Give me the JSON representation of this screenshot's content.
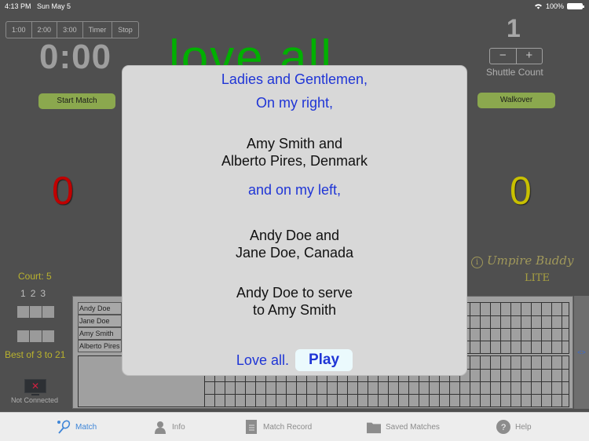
{
  "status_bar": {
    "time": "4:13 PM",
    "date": "Sun May 5",
    "battery": "100%"
  },
  "timer_controls": {
    "options": [
      "1:00",
      "2:00",
      "3:00",
      "Timer",
      "Stop"
    ]
  },
  "clock": "0:00",
  "announcement_bg": "love  all",
  "buttons": {
    "start_match": "Start Match",
    "walkover": "Walkover"
  },
  "shuttle": {
    "count": "1",
    "minus": "−",
    "plus": "+",
    "label": "Shuttle Count"
  },
  "scores": {
    "left": "0",
    "right": "0",
    "left_color": "#c00000",
    "right_color": "#c8c000"
  },
  "brand": {
    "name": "Umpire Buddy",
    "edition": "LITE",
    "info_glyph": "i"
  },
  "match_info": {
    "court": "Court: 5",
    "game_numbers": [
      "1",
      "2",
      "3"
    ],
    "format": "Best of 3 to 21",
    "connection": "Not Connected",
    "connection_glyph": "✕"
  },
  "scoresheet": {
    "players": [
      "Andy Doe",
      "Jane Doe",
      "Amy Smith",
      "Alberto Pires"
    ],
    "nav_label": "<>"
  },
  "dialog": {
    "intro": "Ladies and Gentlemen,",
    "right_intro": "On my right,",
    "right_team_line1": "Amy Smith and",
    "right_team_line2": "Alberto Pires, Denmark",
    "left_intro": "and on my left,",
    "left_team_line1": "Andy Doe and",
    "left_team_line2": "Jane Doe, Canada",
    "serve_line1": "Andy Doe to serve",
    "serve_line2": "to Amy Smith",
    "love_all": "Love all.",
    "play_button": "Play"
  },
  "tabbar": {
    "active": "Match",
    "tabs": [
      {
        "label": "Match",
        "icon": "racket-shuttle-icon"
      },
      {
        "label": "Info",
        "icon": "people-icon"
      },
      {
        "label": "Match Record",
        "icon": "list-document-icon"
      },
      {
        "label": "Saved Matches",
        "icon": "folder-icon"
      },
      {
        "label": "Help",
        "icon": "question-icon"
      }
    ]
  }
}
